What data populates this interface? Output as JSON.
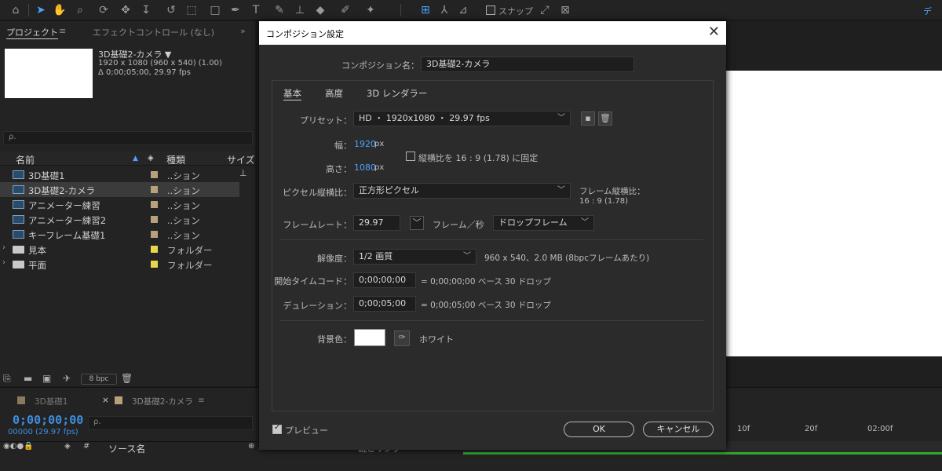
{
  "toolbar": {
    "snap_label": "スナップ",
    "workspace_label": "デ"
  },
  "project_panel": {
    "tab_project": "プロジェクト",
    "tab_project_menu": "≡",
    "tab_effects": "エフェクトコントロール (なし)",
    "overflow": "»",
    "comp_name": "3D基礎2-カメラ ▼",
    "comp_size": "1920 x 1080  (960 x 540) (1.00)",
    "comp_duration": "Δ 0;00;05;00, 29.97 fps",
    "search_icon": "ρ.",
    "columns": {
      "name": "名前",
      "type": "種類",
      "size": "サイズ"
    },
    "items": [
      {
        "name": "3D基礎1",
        "type": "..ション",
        "kind": "comp",
        "label_color": "#b8a07c"
      },
      {
        "name": "3D基礎2-カメラ",
        "type": "..ション",
        "kind": "comp",
        "label_color": "#b8a07c",
        "selected": true
      },
      {
        "name": "アニメーター練習",
        "type": "..ション",
        "kind": "comp",
        "label_color": "#b8a07c"
      },
      {
        "name": "アニメーター練習2",
        "type": "..ション",
        "kind": "comp",
        "label_color": "#b8a07c"
      },
      {
        "name": "キーフレーム基礎1",
        "type": "..ション",
        "kind": "comp",
        "label_color": "#b8a07c"
      },
      {
        "name": "見本",
        "type": "フォルダー",
        "kind": "folder",
        "label_color": "#e6d84a"
      },
      {
        "name": "平面",
        "type": "フォルダー",
        "kind": "folder",
        "label_color": "#e6d84a"
      }
    ],
    "bpc": "8 bpc"
  },
  "timeline": {
    "tabs": [
      {
        "close": "",
        "name": "3D基礎1"
      },
      {
        "close": "×",
        "name": "3D基礎2-カメラ",
        "menu": "≡"
      }
    ],
    "timecode": "0;00;00;00",
    "frames_fps": "00000 (29.97 fps)",
    "search_icon": "ρ.",
    "col_number": "#",
    "col_source": "ソース名",
    "col_parent": "親とリンク",
    "ruler": [
      "10f",
      "20f",
      "02:00f"
    ]
  },
  "dialog": {
    "title": "コンポジション設定",
    "close": "✕",
    "comp_name_label": "コンポジション名：",
    "comp_name_value": "3D基礎2-カメラ",
    "tabs": [
      "基本",
      "高度",
      "3D レンダラー"
    ],
    "preset_label": "プリセット：",
    "preset_value": "HD ・ 1920x1080 ・ 29.97 fps",
    "width_label": "幅：",
    "width_value": "1920",
    "height_label": "高さ：",
    "height_value": "1080",
    "px": "px",
    "lock_aspect_label": "縦横比を 16 : 9 (1.78) に固定",
    "pixel_aspect_label": "ピクセル縦横比：",
    "pixel_aspect_value": "正方形ピクセル",
    "frame_aspect_label": "フレーム縦横比：",
    "frame_aspect_value": "16 : 9 (1.78)",
    "frame_rate_label": "フレームレート：",
    "frame_rate_value": "29.97",
    "frame_rate_unit": "フレーム／秒",
    "drop_frame_value": "ドロップフレーム",
    "resolution_label": "解像度：",
    "resolution_value": "1/2 画質",
    "resolution_info": "960 x 540、2.0 MB (8bpcフレームあたり)",
    "start_tc_label": "開始タイムコード：",
    "start_tc_value": "0;00;00;00",
    "start_tc_info": "= 0;00;00;00  ベース 30   ドロップ",
    "duration_label": "デュレーション：",
    "duration_value": "0;00;05;00",
    "duration_info": "= 0;00;05;00  ベース 30   ドロップ",
    "bg_label": "背景色：",
    "bg_name": "ホワイト",
    "preview_label": "プレビュー",
    "ok": "OK",
    "cancel": "キャンセル"
  }
}
